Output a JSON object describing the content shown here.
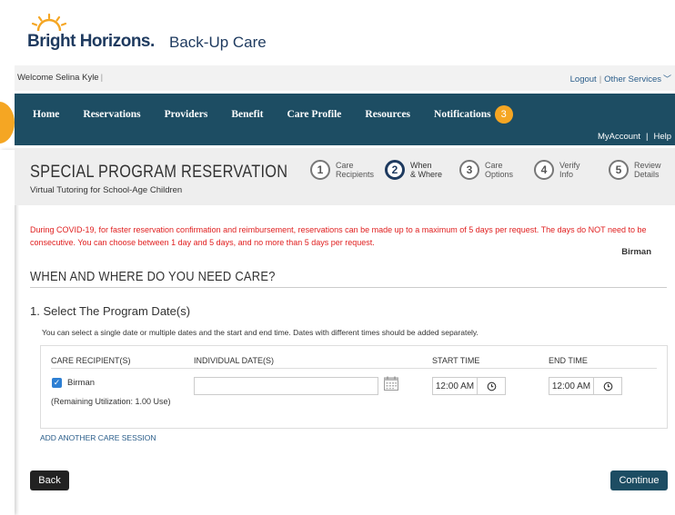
{
  "brand": {
    "logo_text": "Bright Horizons",
    "logo_mark": ".",
    "app_title": "Back-Up Care",
    "logo_color": "#1e3a5f",
    "sun_color": "#f5a623"
  },
  "welcome_bar": {
    "welcome_text": "Welcome Selina Kyle",
    "logout_label": "Logout",
    "other_services_label": "Other Services"
  },
  "nav": {
    "items": [
      {
        "label": "Home"
      },
      {
        "label": "Reservations"
      },
      {
        "label": "Providers"
      },
      {
        "label": "Benefit"
      },
      {
        "label": "Care Profile"
      },
      {
        "label": "Resources"
      },
      {
        "label": "Notifications"
      }
    ],
    "notifications_count": "3",
    "my_account_label": "MyAccount",
    "help_label": "Help",
    "bg_color": "#1d4d63",
    "badge_color": "#f5a623"
  },
  "program": {
    "title": "SPECIAL PROGRAM RESERVATION",
    "subtitle": "Virtual Tutoring for School-Age Children"
  },
  "steps": [
    {
      "number": "1",
      "line1": "Care",
      "line2": "Recipients",
      "active": false
    },
    {
      "number": "2",
      "line1": "When",
      "line2": "& Where",
      "active": true
    },
    {
      "number": "3",
      "line1": "Care",
      "line2": "Options",
      "active": false
    },
    {
      "number": "4",
      "line1": "Verify",
      "line2": "Info",
      "active": false
    },
    {
      "number": "5",
      "line1": "Review",
      "line2": "Details",
      "active": false
    }
  ],
  "notice": {
    "text": "During COVID-19, for faster reservation confirmation and reimbursement, reservations can be made up to a maximum of 5 days per request. The days do NOT need to be consecutive. You can choose between 1 day and 5 days, and no more than 5 days per request.",
    "color": "#e02020",
    "recipient_name": "Birman"
  },
  "section": {
    "title": "WHEN AND WHERE DO YOU NEED CARE?",
    "subsection_title": "1. Select The Program Date(s)",
    "helper_text": "You can select a single date or multiple dates and the start and end time. Dates with different times should be added separately."
  },
  "care_table": {
    "headers": {
      "recipients": "CARE RECIPIENT(S)",
      "dates": "INDIVIDUAL DATE(S)",
      "start": "START TIME",
      "end": "END TIME"
    },
    "recipient_label": "Birman",
    "recipient_checked": true,
    "utilization_text": "(Remaining Utilization: 1.00 Use)",
    "date_value": "",
    "start_time": "12:00 AM",
    "end_time": "12:00 AM"
  },
  "actions": {
    "add_session_label": "ADD ANOTHER CARE SESSION",
    "back_label": "Back",
    "continue_label": "Continue",
    "continue_color": "#1d4d63"
  }
}
